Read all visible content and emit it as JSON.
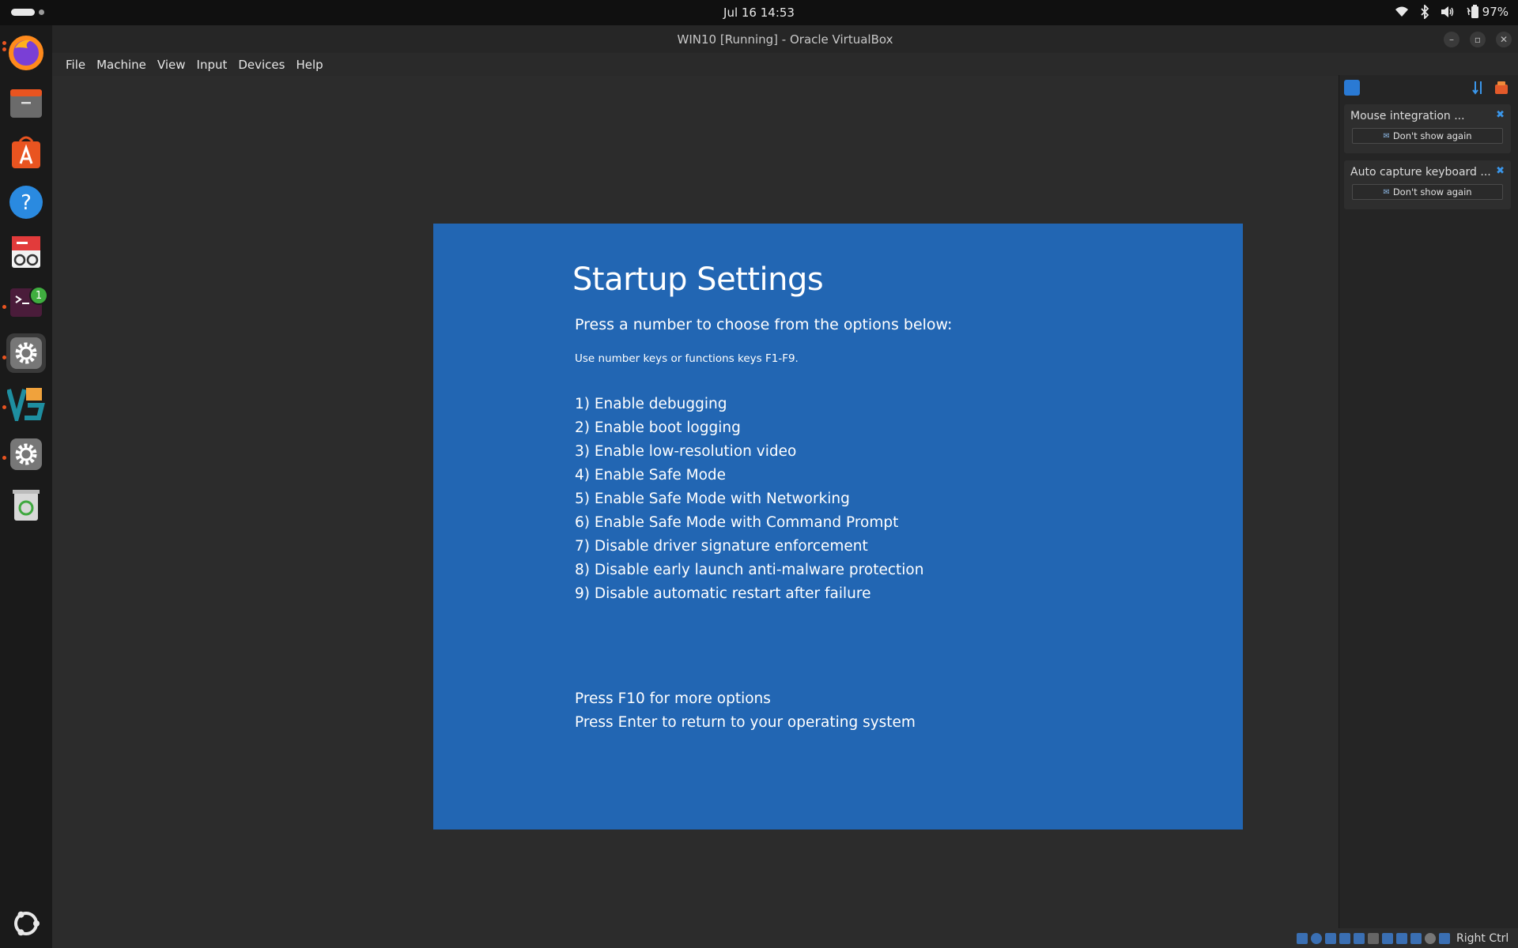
{
  "topbar": {
    "clock": "Jul 16  14:53",
    "battery": "97%"
  },
  "dock": {
    "apps": [
      "Firefox",
      "Files",
      "App Center",
      "Help",
      "Document Viewer",
      "Terminal",
      "Settings",
      "VirtualBox",
      "Settings",
      "Trash"
    ],
    "terminal_badge": "1"
  },
  "window": {
    "title": "WIN10 [Running] - Oracle VirtualBox",
    "menu": [
      "File",
      "Machine",
      "View",
      "Input",
      "Devices",
      "Help"
    ]
  },
  "vm": {
    "title": "Startup Settings",
    "subtitle": "Press a number to choose from the options below:",
    "hint": "Use number keys or functions keys F1-F9.",
    "options": [
      "1) Enable debugging",
      "2) Enable boot logging",
      "3) Enable low-resolution video",
      "4) Enable Safe Mode",
      "5) Enable Safe Mode with Networking",
      "6) Enable Safe Mode with Command Prompt",
      "7) Disable driver signature enforcement",
      "8) Disable early launch anti-malware protection",
      "9) Disable automatic restart after failure"
    ],
    "footer": [
      "Press F10 for more options",
      "Press Enter to return to your operating system"
    ],
    "bg_color": "#2266b3"
  },
  "notifications": [
    {
      "title": "Mouse integration ...",
      "button": "Don't show again"
    },
    {
      "title": "Auto capture keyboard ...",
      "button": "Don't show again"
    }
  ],
  "statusbar": {
    "host_key": "Right Ctrl"
  }
}
